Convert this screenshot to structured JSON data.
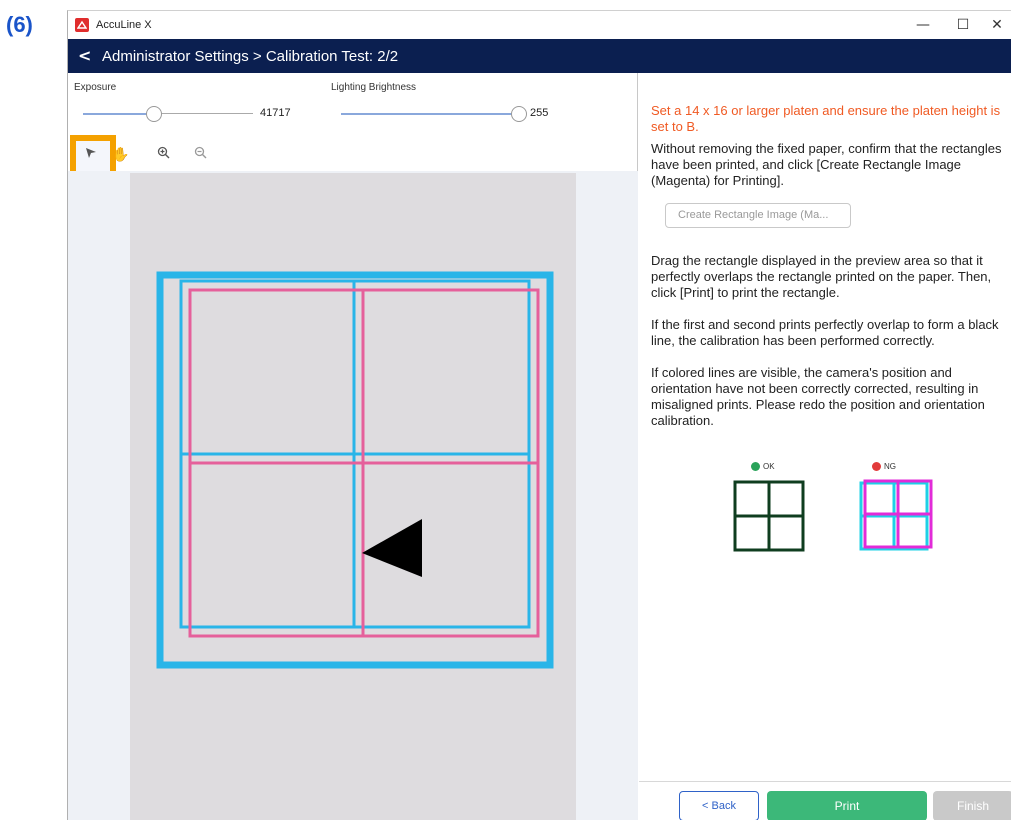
{
  "step_label": "(6)",
  "window": {
    "app_title": "AccuLine X",
    "controls": {
      "minimize": "—",
      "maximize": "☐",
      "close": "✕"
    }
  },
  "navbar": {
    "back_icon": "chevron-left-icon",
    "title": "Administrator Settings > Calibration Test: 2/2"
  },
  "controls": {
    "exposure": {
      "label": "Exposure",
      "value": "41717",
      "level": 0.38
    },
    "brightness": {
      "label": "Lighting Brightness",
      "value": "255",
      "level": 1.0
    }
  },
  "toolbar": {
    "select_icon": "arrow-pointer-icon",
    "pan_icon": "hand-icon",
    "zoom_in_icon": "zoom-in-icon",
    "zoom_out_icon": "zoom-out-icon"
  },
  "instructions": {
    "warning": "Set a 14 x 16 or larger platen and ensure the platen height is set to B.",
    "step1": "Without removing the fixed paper, confirm that the rectangles have been printed, and click [Create Rectangle Image (Magenta) for Printing].",
    "create_button": "Create Rectangle Image (Ma...",
    "step2": "Drag the rectangle displayed in the preview area so that it perfectly overlaps the rectangle printed on the paper. Then, click [Print] to print the rectangle.",
    "step3a": "If the first and second prints perfectly overlap to form a black line, the calibration has been performed correctly.",
    "step3b": "If colored lines are visible, the camera's position and orientation have not been correctly corrected, resulting in misaligned prints. Please redo the position and orientation calibration."
  },
  "examples": {
    "ok_label": "OK",
    "ng_label": "NG"
  },
  "footer": {
    "back": "< Back",
    "print": "Print",
    "finish": "Finish"
  },
  "colors": {
    "navbar": "#0b1f50",
    "cyan_rect": "#29b5e8",
    "magenta_rect": "#e5609b",
    "highlight": "#f4a100",
    "print_button": "#3cb879",
    "warning_text": "#f05a23"
  }
}
